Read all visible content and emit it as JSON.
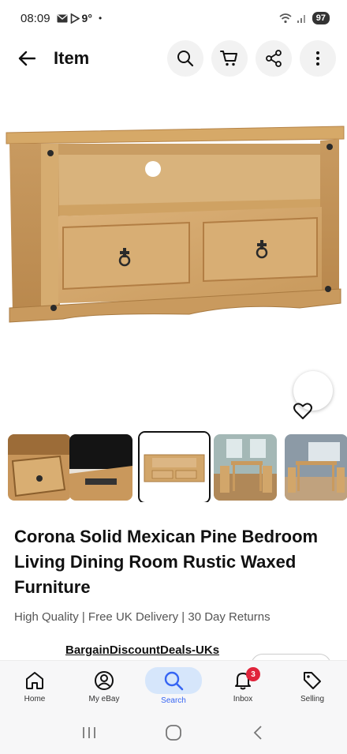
{
  "status": {
    "time": "08:09",
    "temp": "9°",
    "battery": "97",
    "icons": [
      "mail-icon",
      "play-icon",
      "dot-icon",
      "wifi-icon",
      "signal-icon"
    ]
  },
  "app_bar": {
    "title": "Item",
    "actions": [
      "search-icon",
      "cart-icon",
      "share-icon",
      "more-vertical-icon"
    ]
  },
  "hero": {
    "favorite_icon": "heart-icon"
  },
  "thumbnails": {
    "count": 5,
    "selected_index": 2
  },
  "item": {
    "title": "Corona Solid Mexican Pine Bedroom Living Dining Room Rustic Waxed Furniture",
    "subtitle": "High Quality | Free UK Delivery | 30 Day Returns",
    "seller": "BargainDiscountDeals-UKs"
  },
  "bottom_nav": {
    "items": [
      {
        "label": "Home",
        "icon": "home-icon"
      },
      {
        "label": "My eBay",
        "icon": "account-icon"
      },
      {
        "label": "Search",
        "icon": "search-icon"
      },
      {
        "label": "Inbox",
        "icon": "bell-icon"
      },
      {
        "label": "Selling",
        "icon": "tag-icon"
      }
    ],
    "active": "Search",
    "inbox_badge": "3"
  },
  "system_nav": [
    "recents-icon",
    "home-icon",
    "back-icon"
  ],
  "colors": {
    "accent": "#3665f3",
    "active_pill": "#d6e6fb",
    "badge": "#e0243b",
    "wood": "#d2a66a"
  }
}
